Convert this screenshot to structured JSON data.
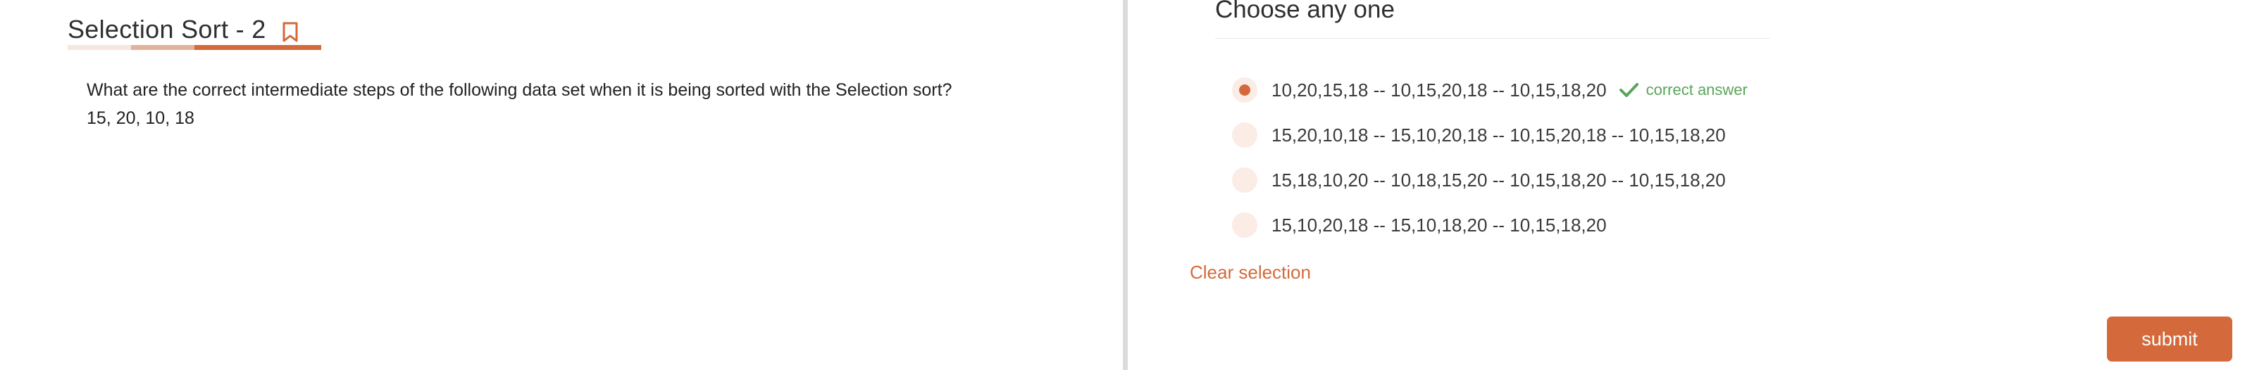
{
  "header": {
    "title": "Selection Sort - 2",
    "bookmark_icon": "bookmark-icon",
    "progress_fraction": 1.0
  },
  "question": {
    "text": "What are the correct intermediate steps of the following data set when it is being sorted with the Selection sort?",
    "data": "15, 20, 10, 18"
  },
  "answers": {
    "heading": "Choose any one",
    "options": [
      {
        "label": "10,20,15,18 -- 10,15,20,18 -- 10,15,18,20",
        "selected": true
      },
      {
        "label": "15,20,10,18 -- 15,10,20,18 -- 10,15,20,18 -- 10,15,18,20",
        "selected": false
      },
      {
        "label": "15,18,10,20 -- 10,18,15,20 -- 10,15,18,20 -- 10,15,18,20",
        "selected": false
      },
      {
        "label": "15,10,20,18 -- 15,10,18,20 -- 10,15,18,20",
        "selected": false
      }
    ],
    "feedback": "correct answer",
    "feedback_icon": "check-icon",
    "clear_label": "Clear selection"
  },
  "footer": {
    "submit_label": "submit"
  },
  "colors": {
    "accent": "#d46a3b",
    "radio_bg": "#fbece5",
    "correct": "#5aa55a",
    "divider": "#dcdcdc"
  }
}
